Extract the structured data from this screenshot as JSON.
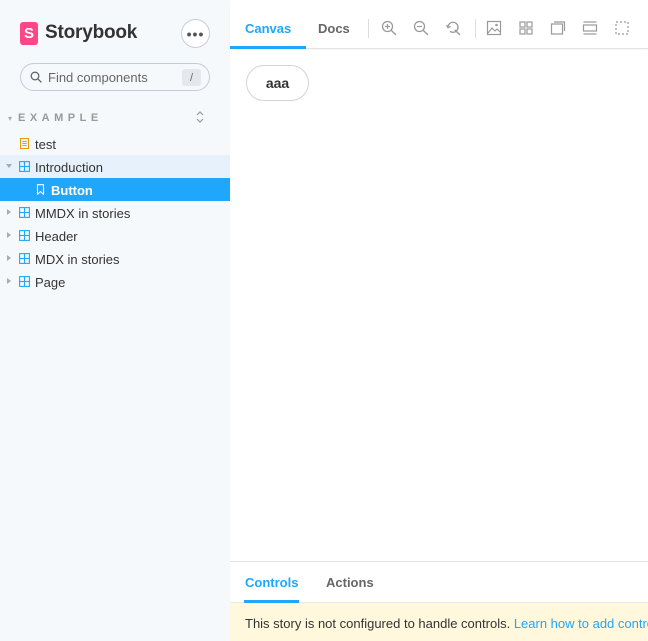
{
  "app": {
    "name": "Storybook",
    "logo_letter": "S",
    "menu_label": "•••"
  },
  "search": {
    "placeholder": "Find components",
    "shortcut": "/"
  },
  "sidebar": {
    "group_title": "EXAMPLE",
    "items": [
      {
        "label": "test",
        "icon": "document-icon",
        "state": "default"
      },
      {
        "label": "Introduction",
        "icon": "component-icon",
        "state": "expanded"
      },
      {
        "label": "Button",
        "icon": "bookmark-icon",
        "state": "selected"
      },
      {
        "label": "MMDX in stories",
        "icon": "component-icon",
        "state": "collapsed"
      },
      {
        "label": "Header",
        "icon": "component-icon",
        "state": "collapsed"
      },
      {
        "label": "MDX in stories",
        "icon": "component-icon",
        "state": "collapsed"
      },
      {
        "label": "Page",
        "icon": "component-icon",
        "state": "collapsed"
      }
    ]
  },
  "toolbar": {
    "tabs": [
      {
        "label": "Canvas",
        "active": true
      },
      {
        "label": "Docs",
        "active": false
      }
    ],
    "tools": [
      "zoom-in-icon",
      "zoom-out-icon",
      "zoom-reset-icon",
      "background-icon",
      "grid-icon",
      "viewport-icon",
      "measure-icon",
      "outline-icon"
    ]
  },
  "canvas": {
    "button_label": "aaa"
  },
  "addons": {
    "tabs": [
      {
        "label": "Controls",
        "active": true
      },
      {
        "label": "Actions",
        "active": false
      }
    ],
    "notice_text": "This story is not configured to handle controls. ",
    "notice_link": "Learn how to add controls »"
  },
  "colors": {
    "accent": "#1ea7fd",
    "brand": "#ff4785",
    "sidebar_bg": "#f6f9fc",
    "notice_bg": "#fff8dc",
    "doc_icon": "#e69d00",
    "component_icon": "#1ea7fd"
  }
}
